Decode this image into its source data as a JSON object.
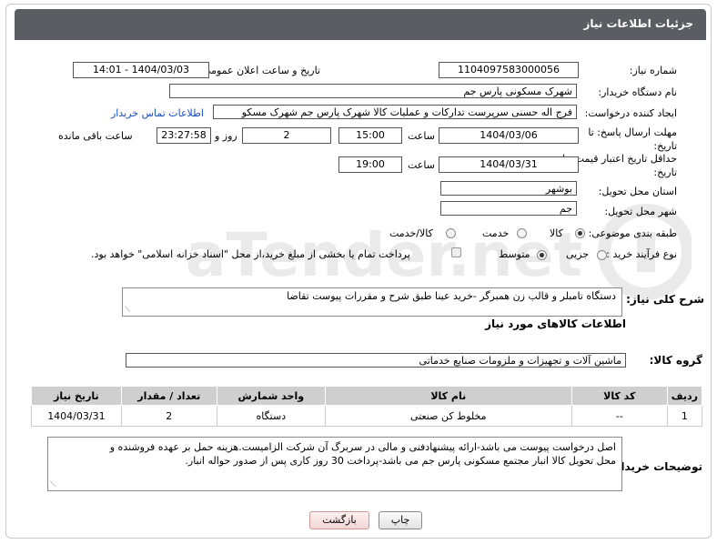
{
  "header": {
    "title": "جزئیات اطلاعات نیاز"
  },
  "fields": {
    "need_number_label": "شماره نیاز:",
    "need_number": "1104097583000056",
    "announce_label": "تاریخ و ساعت اعلان عمومی:",
    "announce_value": "1404/03/03 - 14:01",
    "buyer_label": "نام دستگاه خریدار:",
    "buyer_value": "شهرک مسکونی پارس جم",
    "creator_label": "ایجاد کننده درخواست:",
    "creator_value": "فرج اله حسنی سرپرست تدارکات و عملیات کالا شهرک پارس جم شهرک مسکو",
    "contact_link": "اطلاعات تماس خریدار",
    "reply_deadline_label": "مهلت ارسال پاسخ: تا تاریخ:",
    "reply_date": "1404/03/06",
    "time_label": "ساعت",
    "reply_time": "15:00",
    "days_value": "2",
    "days_label": "روز و",
    "remaining_time": "23:27:58",
    "remaining_label": "ساعت باقی مانده",
    "price_validity_label": "حداقل تاریخ اعتبار قیمت: تا تاریخ:",
    "price_date": "1404/03/31",
    "price_time": "19:00",
    "province_label": "استان محل تحویل:",
    "province_value": "بوشهر",
    "city_label": "شهر محل تحویل:",
    "city_value": "جم",
    "category_label": "طبقه بندی موضوعی:",
    "category_options": [
      "کالا",
      "خدمت",
      "کالا/خدمت"
    ],
    "category_selected": "کالا",
    "process_label": "نوع فرآیند خرید :",
    "process_options": [
      "جزیی",
      "متوسط"
    ],
    "process_selected": "متوسط",
    "payment_note": "پرداخت تمام یا بخشی از مبلغ خرید،از محل \"اسناد خزانه اسلامی\" خواهد بود."
  },
  "description": {
    "label": "شرح کلی نیاز:",
    "value": "دستگاه تامبلر و قالب زن همبرگر -خرید عینا طبق شرح و مقررات پیوست تقاضا"
  },
  "goods_section": {
    "title": "اطلاعات کالاهای مورد نیاز",
    "group_label": "گروه کالا:",
    "group_value": "ماشین آلات و تجهیزات و ملزومات صنایع خدماتی"
  },
  "table": {
    "columns": [
      "ردیف",
      "کد کالا",
      "نام کالا",
      "واحد شمارش",
      "تعداد / مقدار",
      "تاریخ نیاز"
    ],
    "rows": [
      [
        "1",
        "--",
        "مخلوط کن صنعتی",
        "دستگاه",
        "2",
        "1404/03/31"
      ]
    ]
  },
  "buyer_notes": {
    "label": "توضیحات خریدار:",
    "line1": "اصل درخواست پیوست می باشد-ارائه پیشنهادفنی و مالی در سربرگ آن شرکت الزامیست.هزینه حمل بر عهده فروشنده و",
    "line2": "محل تحویل کالا انبار مجتمع مسکونی پارس جم می باشد-پرداخت  30 روز کاری پس از صدور حواله انبار."
  },
  "buttons": {
    "print": "چاپ",
    "back": "بازگشت"
  },
  "watermark": {
    "text": "AriaTender.net"
  },
  "colors": {
    "header_bg": "#5a5d62",
    "table_header_bg": "#cfcfcf",
    "link": "#1a4fc4",
    "back_btn": "#f3d6d6"
  }
}
